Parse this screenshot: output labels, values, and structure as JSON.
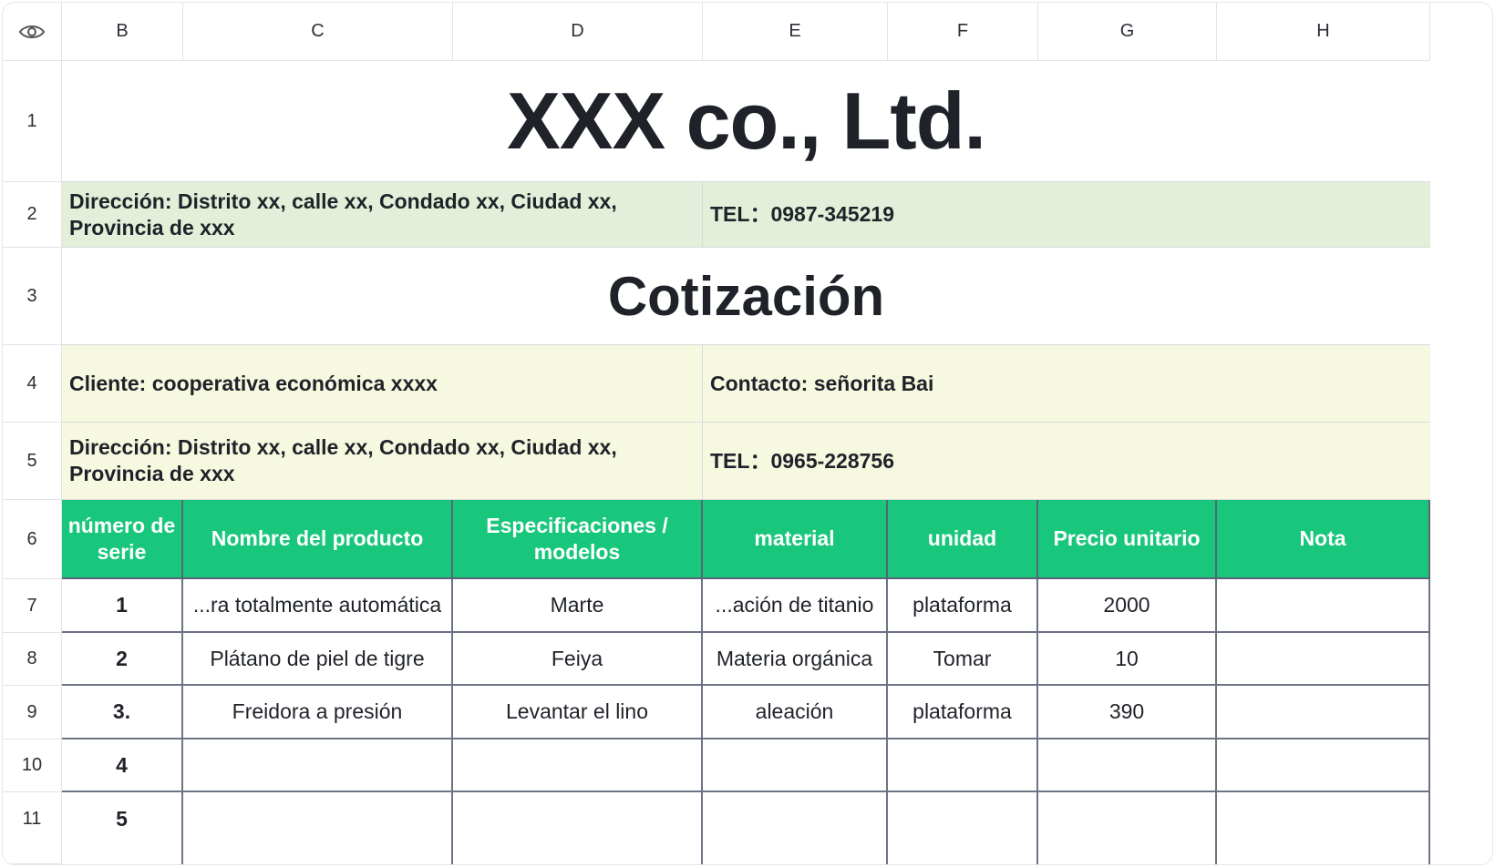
{
  "column_headers": [
    "B",
    "C",
    "D",
    "E",
    "F",
    "G",
    "H"
  ],
  "row_headers": [
    "1",
    "2",
    "3",
    "4",
    "5",
    "6",
    "7",
    "8",
    "9",
    "10",
    "11"
  ],
  "company": {
    "name": "XXX co., Ltd."
  },
  "company_info": {
    "address": "Dirección: Distrito xx, calle xx, Condado xx, Ciudad xx, Provincia de xxx",
    "tel": "TEL：0987-345219"
  },
  "doc_title": "Cotización",
  "client": {
    "name": "Cliente: cooperativa económica xxxx",
    "contact": "Contacto: señorita Bai",
    "address": "Dirección: Distrito xx, calle xx, Condado xx, Ciudad xx, Provincia de xxx",
    "tel": "TEL：0965-228756"
  },
  "table": {
    "headers": [
      "número de serie",
      "Nombre del producto",
      "Especificaciones / modelos",
      "material",
      "unidad",
      "Precio unitario",
      "Nota"
    ],
    "rows": [
      [
        "1",
        "...ra totalmente automática",
        "Marte",
        "...ación de titanio",
        "plataforma",
        "2000",
        ""
      ],
      [
        "2",
        "Plátano de piel de tigre",
        "Feiya",
        "Materia orgánica",
        "Tomar",
        "10",
        ""
      ],
      [
        "3.",
        "Freidora a presión",
        "Levantar el lino",
        "aleación",
        "plataforma",
        "390",
        ""
      ],
      [
        "4",
        "",
        "",
        "",
        "",
        "",
        ""
      ],
      [
        "5",
        "",
        "",
        "",
        "",
        "",
        ""
      ]
    ]
  },
  "colors": {
    "header_green": "#19c77c",
    "band_green": "#e3efd9",
    "band_yellow": "#f6f8e0"
  },
  "icons": {
    "corner": "eye-icon"
  }
}
